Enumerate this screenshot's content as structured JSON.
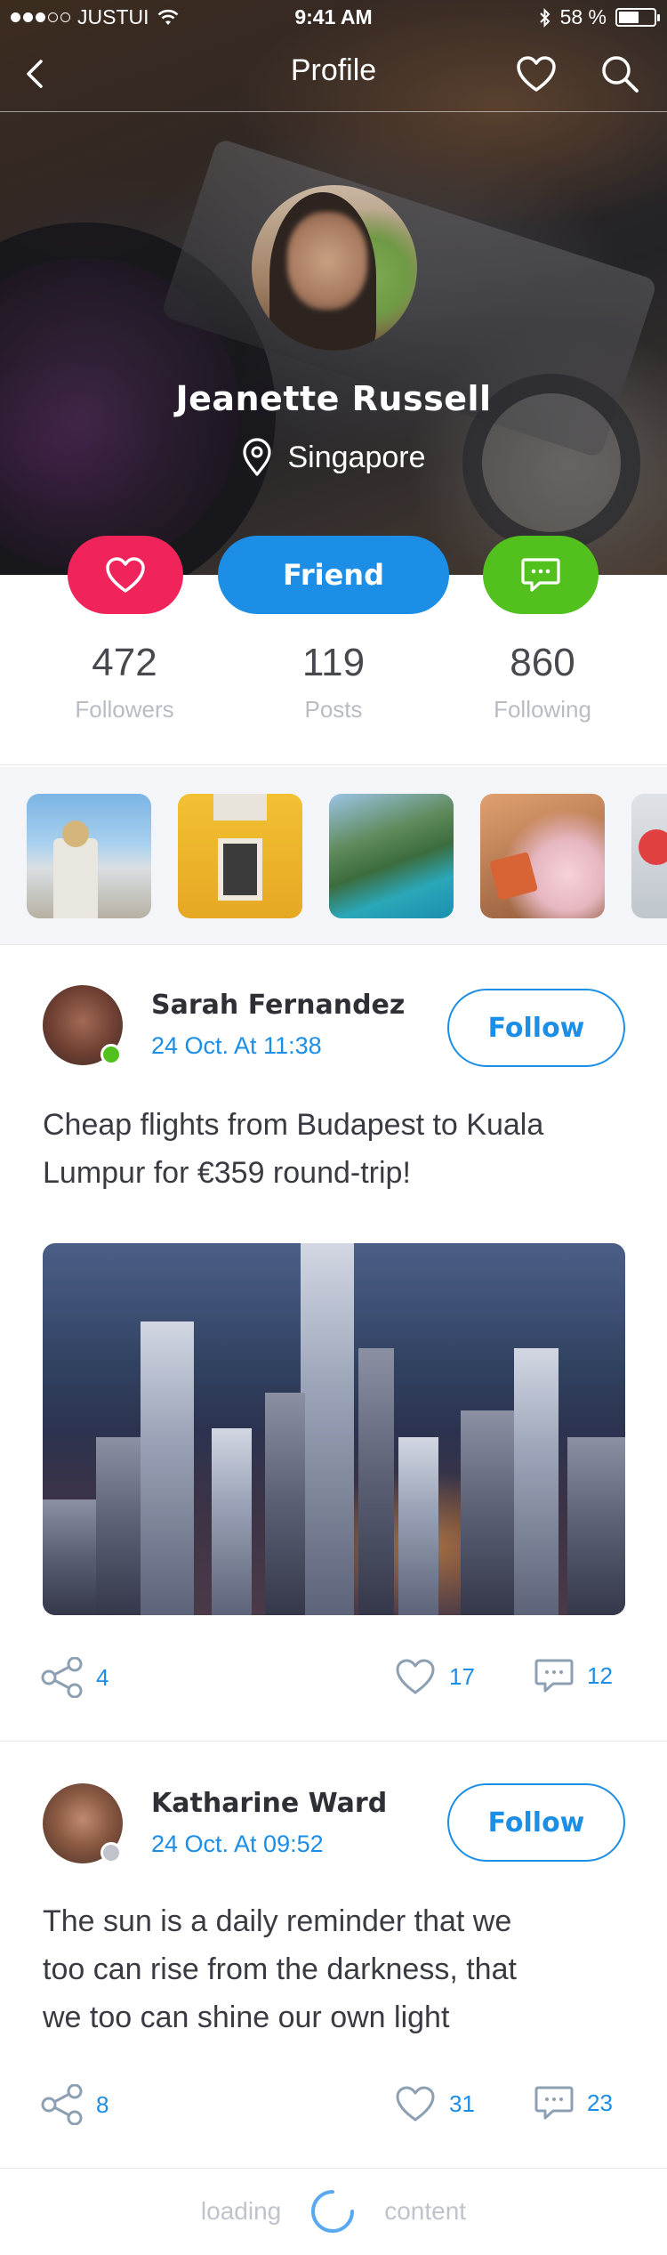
{
  "status_bar": {
    "carrier": "JUSTUI",
    "time": "9:41 AM",
    "battery_percent": "58 %",
    "battery_level": 0.58,
    "signal_bars_filled": 3,
    "signal_bars_total": 5
  },
  "nav": {
    "title": "Profile",
    "back_icon": "chevron-left-icon",
    "favorite_icon": "heart-icon",
    "search_icon": "search-icon"
  },
  "profile": {
    "name": "Jeanette Russell",
    "location": "Singapore",
    "location_icon": "location-pin-icon"
  },
  "actions": {
    "like_icon": "heart-icon",
    "friend_label": "Friend",
    "message_icon": "chat-icon",
    "colors": {
      "like": "#f0245a",
      "friend": "#1c8ee6",
      "message": "#52c11e"
    }
  },
  "stats": [
    {
      "value": "472",
      "label": "Followers"
    },
    {
      "value": "119",
      "label": "Posts"
    },
    {
      "value": "860",
      "label": "Following"
    }
  ],
  "posts": [
    {
      "author": "Sarah Fernandez",
      "time": "24 Oct. At 11:38",
      "follow_label": "Follow",
      "online": true,
      "status_color": "#52c11e",
      "text_lines": [
        "Cheap flights from Budapest to Kuala",
        "Lumpur for €359 round-trip!"
      ],
      "shares": "4",
      "likes": "17",
      "comments": "12"
    },
    {
      "author": "Katharine Ward",
      "time": "24 Oct. At 09:52",
      "follow_label": "Follow",
      "online": false,
      "status_color": "#c0c3cb",
      "text_lines": [
        "The sun is a daily reminder that we",
        "too can rise from the darkness, that",
        "we too can shine our own light"
      ],
      "shares": "8",
      "likes": "31",
      "comments": "23"
    }
  ],
  "footer": {
    "loading_left": "loading",
    "loading_right": "content"
  },
  "accent_color": "#1c8ee6"
}
